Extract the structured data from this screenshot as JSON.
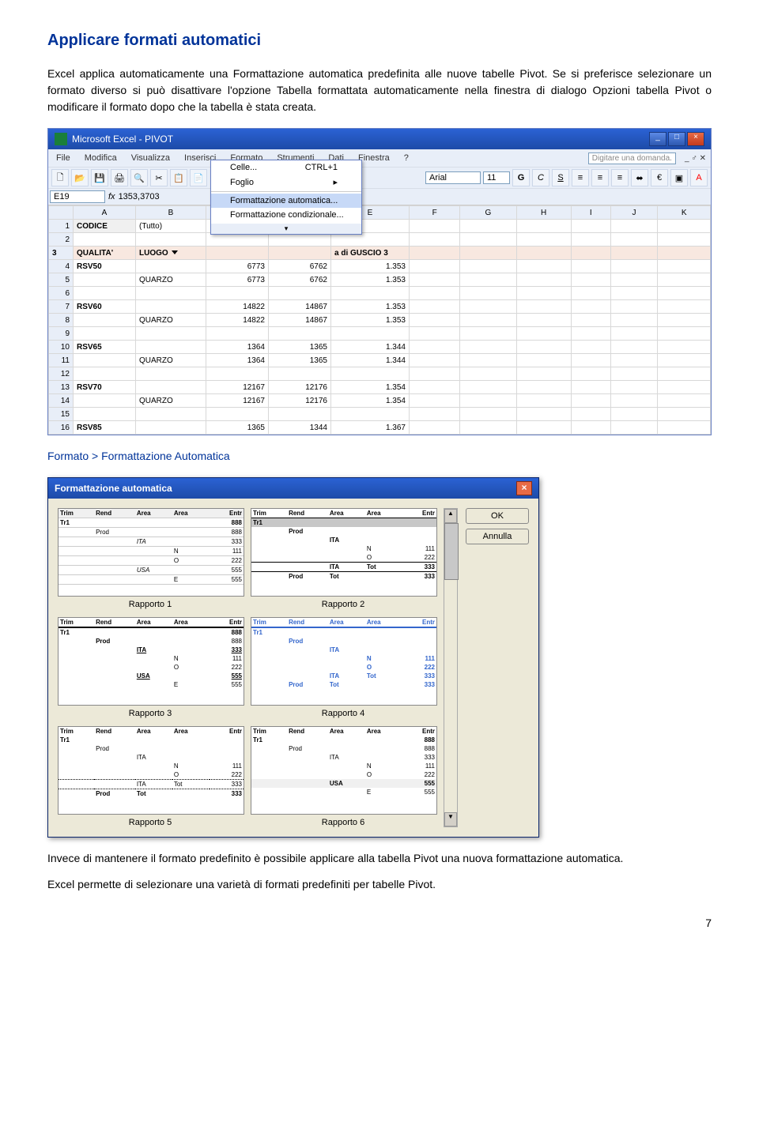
{
  "heading": "Applicare formati automatici",
  "para1": "Excel applica automaticamente una Formattazione automatica predefinita alle nuove tabelle Pivot. Se si preferisce selezionare un formato diverso si può disattivare l'opzione Tabella formattata automaticamente nella finestra di dialogo Opzioni tabella Pivot o modificare il formato dopo che la tabella è stata creata.",
  "excel": {
    "app_title": "Microsoft Excel - PIVOT",
    "menus": [
      "File",
      "Modifica",
      "Visualizza",
      "Inserisci",
      "Formato",
      "Strumenti",
      "Dati",
      "Finestra",
      "?"
    ],
    "ask_placeholder": "Digitare una domanda.",
    "format_menu": {
      "celle": "Celle...",
      "celle_sc": "CTRL+1",
      "foglio": "Foglio",
      "auto": "Formattazione automatica...",
      "cond": "Formattazione condizionale..."
    },
    "font_name": "Arial",
    "font_size": "11",
    "namebox": "E19",
    "formula": "1353,3703",
    "col_headers": [
      "A",
      "B",
      "C",
      "D",
      "E",
      "F",
      "G",
      "H",
      "I",
      "J",
      "K"
    ],
    "rows": {
      "r1": {
        "A": "CODICE",
        "B": "(Tutto)"
      },
      "r3": {
        "A": "QUALITA'",
        "B": "LUOGO",
        "E": "a di GUSCIO 3"
      },
      "r4": {
        "A": "RSV50",
        "C": "6773",
        "D": "6762",
        "E": "1.353"
      },
      "r5": {
        "B": "QUARZO",
        "C": "6773",
        "D": "6762",
        "E": "1.353"
      },
      "r7": {
        "A": "RSV60",
        "C": "14822",
        "D": "14867",
        "E": "1.353"
      },
      "r8": {
        "B": "QUARZO",
        "C": "14822",
        "D": "14867",
        "E": "1.353"
      },
      "r10": {
        "A": "RSV65",
        "C": "1364",
        "D": "1365",
        "E": "1.344"
      },
      "r11": {
        "B": "QUARZO",
        "C": "1364",
        "D": "1365",
        "E": "1.344"
      },
      "r13": {
        "A": "RSV70",
        "C": "12167",
        "D": "12176",
        "E": "1.354"
      },
      "r14": {
        "B": "QUARZO",
        "C": "12167",
        "D": "12176",
        "E": "1.354"
      },
      "r16": {
        "A": "RSV85",
        "C": "1365",
        "D": "1344",
        "E": "1.367"
      }
    }
  },
  "menu_path": "Formato > Formattazione Automatica",
  "dialog": {
    "title": "Formattazione automatica",
    "ok": "OK",
    "cancel": "Annulla",
    "labels": [
      "Rapporto 1",
      "Rapporto 2",
      "Rapporto 3",
      "Rapporto 4",
      "Rapporto 5",
      "Rapporto 6"
    ],
    "sample": {
      "cols": [
        "Trim",
        "Rend",
        "Area",
        "Area",
        "Entr"
      ],
      "tr1": "Tr1",
      "prod": "Prod",
      "ita": "ITA",
      "usa": "USA",
      "n": "N",
      "o": "O",
      "e": "E",
      "tot": "Tot",
      "v888": "888",
      "v333": "333",
      "v111": "111",
      "v222": "222",
      "v555": "555"
    }
  },
  "para2": "Invece di mantenere il formato predefinito è possibile applicare alla tabella Pivot una nuova formattazione automatica.",
  "para3": "Excel permette di selezionare una varietà di formati predefiniti per tabelle Pivot.",
  "page_num": "7"
}
